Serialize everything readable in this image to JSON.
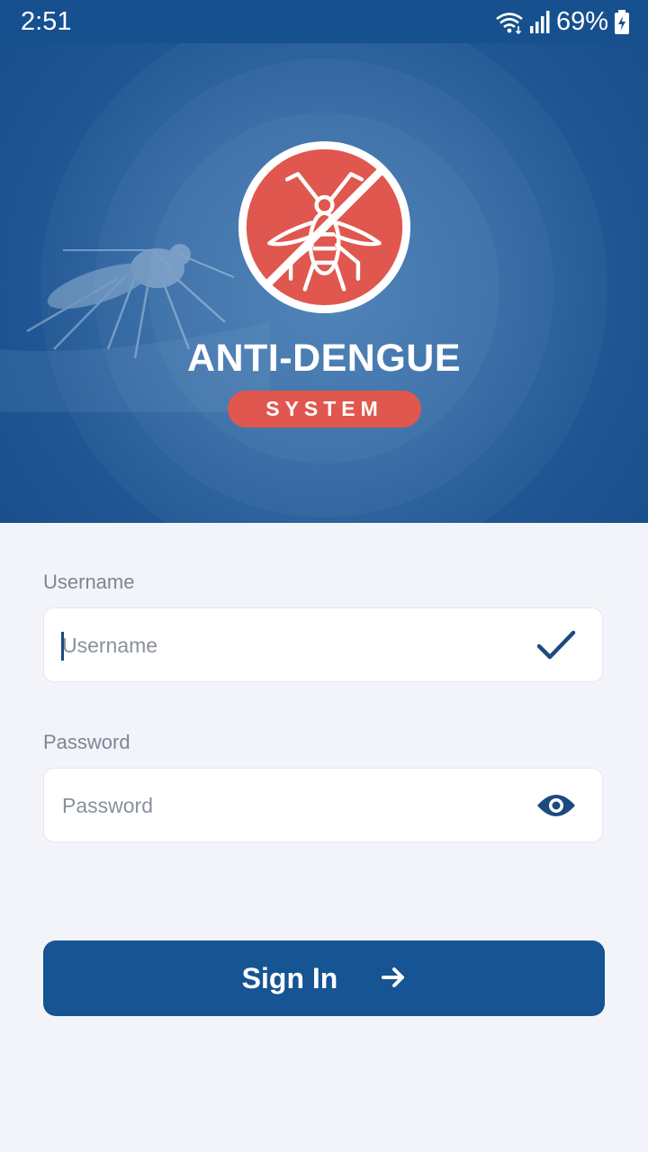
{
  "status_bar": {
    "time": "2:51",
    "battery_percent": "69%",
    "icons": [
      "wifi-icon",
      "signal-icon",
      "battery-charging-icon"
    ]
  },
  "hero": {
    "title": "ANTI-DENGUE",
    "badge": "SYSTEM",
    "logo_icon": "no-mosquito-icon"
  },
  "form": {
    "username": {
      "label": "Username",
      "placeholder": "Username",
      "value": "",
      "trailing_icon": "check-icon"
    },
    "password": {
      "label": "Password",
      "placeholder": "Password",
      "value": "",
      "trailing_icon": "eye-icon"
    },
    "submit": {
      "label": "Sign In",
      "icon": "arrow-right-icon"
    }
  },
  "colors": {
    "primary": "#165493",
    "accent": "#e0574f",
    "background": "#f2f4f9",
    "status_bar": "#17508e"
  }
}
